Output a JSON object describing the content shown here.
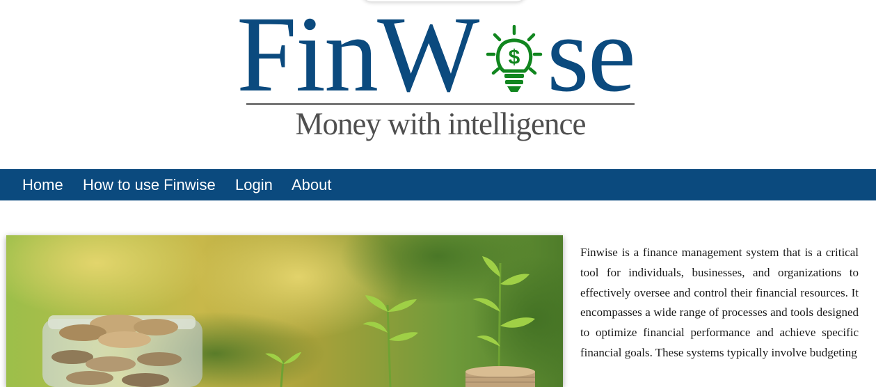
{
  "logo": {
    "brand": "FinWise",
    "brand_left": "FinW",
    "brand_right": "se",
    "tagline": "Money with intelligence",
    "brand_color": "#0b4a7e",
    "bulb_color": "#11861f",
    "tagline_color": "#4f4f4f",
    "bulb_icon": "lightbulb-dollar-icon"
  },
  "nav": {
    "background": "#0b4a7e",
    "items": [
      {
        "label": "Home"
      },
      {
        "label": "How to use Finwise"
      },
      {
        "label": "Login"
      },
      {
        "label": "About"
      }
    ]
  },
  "hero": {
    "image": "jar-of-coins-with-seedlings-photo"
  },
  "description": {
    "text": "Finwise is a finance management system that is a critical tool for individuals, businesses, and organizations to effectively oversee and control their financial resources. It encompasses a wide range of processes and tools designed to optimize financial performance and achieve specific financial goals. These systems typically involve budgeting"
  }
}
